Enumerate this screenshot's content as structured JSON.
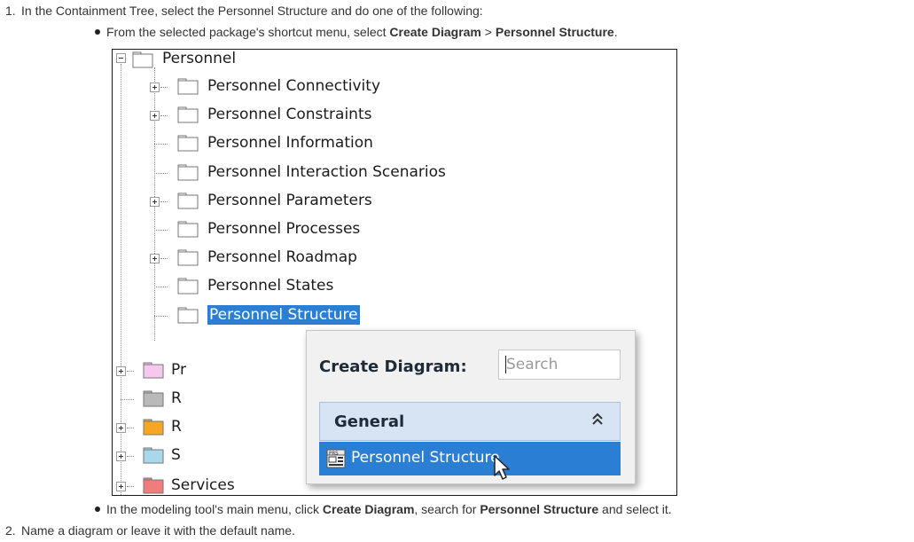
{
  "steps": [
    {
      "number": "1.",
      "text": "In the Containment Tree, select the Personnel Structure and do one of the following:",
      "bullets": [
        {
          "prefix": "From the selected package's shortcut menu, select ",
          "bold1": "Create Diagram",
          "mid": " > ",
          "bold2": "Personnel Structure",
          "suffix": "."
        },
        {
          "prefix": "In the modeling tool's main menu, click ",
          "bold1": "Create Diagram",
          "mid": ", search for ",
          "bold2": "Personnel Structure",
          "suffix": " and select it."
        }
      ]
    },
    {
      "number": "2.",
      "text": "Name a diagram or leave it with the default name."
    }
  ],
  "tree": {
    "root": {
      "label": "Personnel"
    },
    "children": [
      {
        "label": "Personnel Connectivity",
        "expandable": true
      },
      {
        "label": "Personnel Constraints",
        "expandable": true
      },
      {
        "label": "Personnel Information",
        "expandable": false
      },
      {
        "label": "Personnel Interaction Scenarios",
        "expandable": false
      },
      {
        "label": "Personnel Parameters",
        "expandable": true
      },
      {
        "label": "Personnel Processes",
        "expandable": false
      },
      {
        "label": "Personnel Roadmap",
        "expandable": true
      },
      {
        "label": "Personnel States",
        "expandable": false
      },
      {
        "label": "Personnel Structure",
        "expandable": false,
        "selected": true
      }
    ],
    "siblings": [
      {
        "label": "Pr",
        "color": "#f7c8ee"
      },
      {
        "label": "R",
        "color": "#b9b9b9"
      },
      {
        "label": "R",
        "color": "#f5a623"
      },
      {
        "label": "S",
        "color": "#a9d8ea"
      },
      {
        "label": "Services",
        "color": "#f07c7c"
      }
    ]
  },
  "popup": {
    "title": "Create Diagram:",
    "search_placeholder": "Search",
    "group_label": "General",
    "group_icon": "double-chevron-up-icon",
    "item_label": "Personnel Structure",
    "item_icon": "personnel-structure-diagram-icon"
  },
  "colors": {
    "selection": "#2a7fd5",
    "group_background": "#d6e4f4",
    "package_default": "#ffffff"
  }
}
